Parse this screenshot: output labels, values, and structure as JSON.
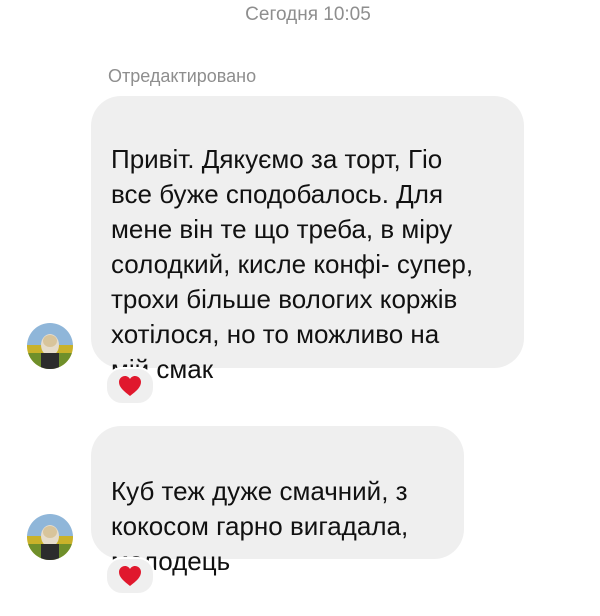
{
  "thread": {
    "timestamp": "Сегодня 10:05",
    "edited_label": "Отредактировано"
  },
  "messages": [
    {
      "text": "Привіт.  Дякуємо за торт, Гіо\nвсе буже сподобалось. Для\nмене він те що треба, в міру\nсолодкий, кисле конфі- супер,\nтрохи більше вологих коржів\nхотілося, но то можливо на\nмій смак",
      "reaction_icon": "heart-icon"
    },
    {
      "text": "Куб теж дуже смачний, з\nкокосом гарно вигадала,\nмолодець",
      "reaction_icon": "heart-icon"
    }
  ],
  "colors": {
    "bubble_background": "#efefef",
    "meta_text": "#8e8e8e",
    "heart": "#e0182d"
  }
}
